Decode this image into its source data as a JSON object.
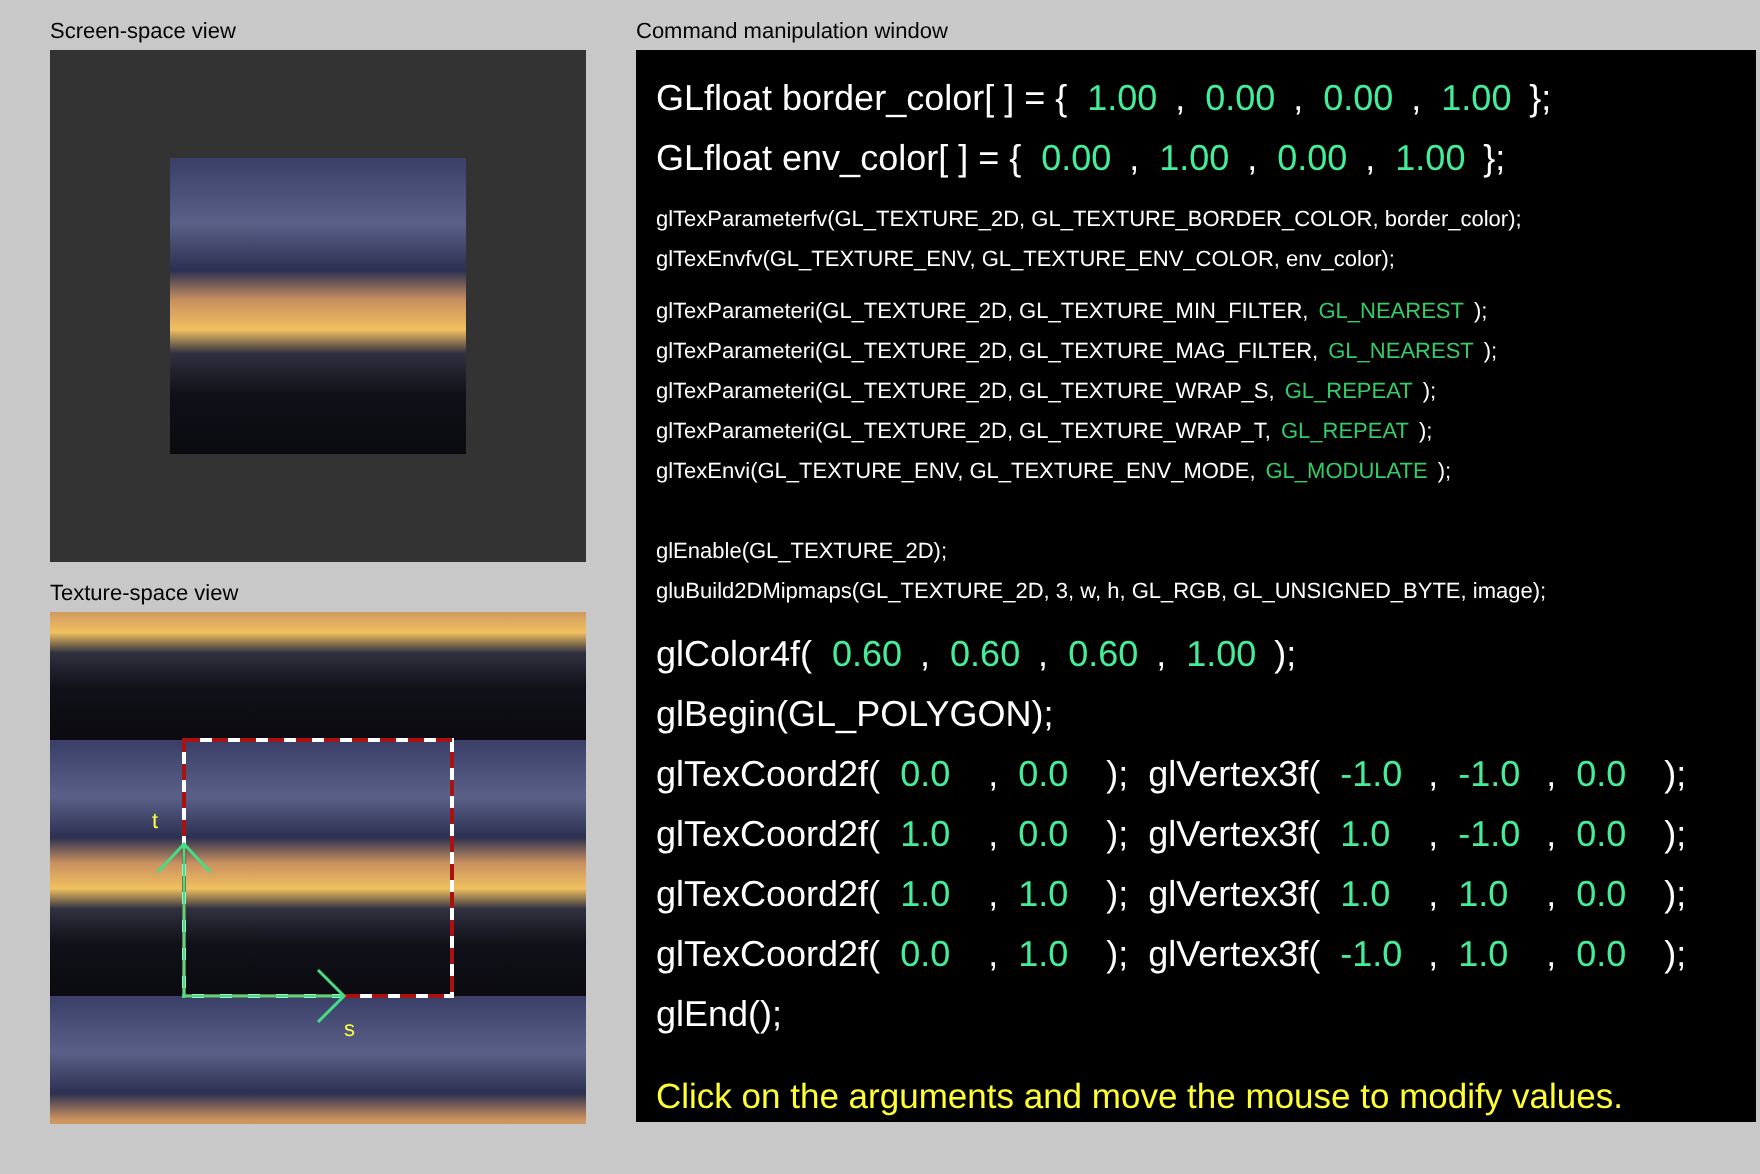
{
  "screen_view": {
    "title": "Screen-space view"
  },
  "texture_view": {
    "title": "Texture-space view",
    "t_label": "t",
    "s_label": "s"
  },
  "command_window": {
    "title": "Command manipulation window",
    "blocks": [
      [
        {
          "kind": "primary",
          "parts": [
            {
              "kind": "code",
              "text": "GLfloat border_color[ ] = {"
            },
            {
              "kind": "arg",
              "text": "1.00"
            },
            {
              "kind": "code",
              "text": ","
            },
            {
              "kind": "arg",
              "text": "0.00"
            },
            {
              "kind": "code",
              "text": ","
            },
            {
              "kind": "arg",
              "text": "0.00"
            },
            {
              "kind": "code",
              "text": ","
            },
            {
              "kind": "arg",
              "text": "1.00"
            },
            {
              "kind": "code",
              "text": "};"
            }
          ]
        },
        {
          "kind": "primary",
          "parts": [
            {
              "kind": "code",
              "text": "GLfloat env_color[ ] = {"
            },
            {
              "kind": "arg",
              "text": "0.00"
            },
            {
              "kind": "code",
              "text": ","
            },
            {
              "kind": "arg",
              "text": "1.00"
            },
            {
              "kind": "code",
              "text": ","
            },
            {
              "kind": "arg",
              "text": "0.00"
            },
            {
              "kind": "code",
              "text": ","
            },
            {
              "kind": "arg",
              "text": "1.00"
            },
            {
              "kind": "code",
              "text": "};"
            }
          ]
        }
      ],
      [
        {
          "kind": "secondary",
          "parts": [
            {
              "kind": "code",
              "text": "glTexParameterfv(GL_TEXTURE_2D, GL_TEXTURE_BORDER_COLOR, border_color);"
            }
          ]
        },
        {
          "kind": "secondary",
          "parts": [
            {
              "kind": "code",
              "text": "glTexEnvfv(GL_TEXTURE_ENV, GL_TEXTURE_ENV_COLOR, env_color);"
            }
          ]
        }
      ],
      [
        {
          "kind": "secondary",
          "parts": [
            {
              "kind": "code",
              "text": "glTexParameteri(GL_TEXTURE_2D, GL_TEXTURE_MIN_FILTER,"
            },
            {
              "kind": "arg",
              "text": "GL_NEAREST"
            },
            {
              "kind": "code",
              "text": ");"
            }
          ]
        },
        {
          "kind": "secondary",
          "parts": [
            {
              "kind": "code",
              "text": "glTexParameteri(GL_TEXTURE_2D, GL_TEXTURE_MAG_FILTER,"
            },
            {
              "kind": "arg",
              "text": "GL_NEAREST"
            },
            {
              "kind": "code",
              "text": ");"
            }
          ]
        },
        {
          "kind": "secondary",
          "parts": [
            {
              "kind": "code",
              "text": "glTexParameteri(GL_TEXTURE_2D, GL_TEXTURE_WRAP_S,"
            },
            {
              "kind": "arg",
              "text": "GL_REPEAT"
            },
            {
              "kind": "code",
              "text": ");"
            }
          ]
        },
        {
          "kind": "secondary",
          "parts": [
            {
              "kind": "code",
              "text": "glTexParameteri(GL_TEXTURE_2D, GL_TEXTURE_WRAP_T,"
            },
            {
              "kind": "arg",
              "text": "GL_REPEAT"
            },
            {
              "kind": "code",
              "text": ");"
            }
          ]
        },
        {
          "kind": "secondary",
          "parts": [
            {
              "kind": "code",
              "text": "glTexEnvi(GL_TEXTURE_ENV, GL_TEXTURE_ENV_MODE,"
            },
            {
              "kind": "arg",
              "text": "GL_MODULATE"
            },
            {
              "kind": "code",
              "text": ");"
            }
          ]
        }
      ],
      [
        {
          "kind": "secondary",
          "parts": [
            {
              "kind": "code",
              "text": "glEnable(GL_TEXTURE_2D);"
            }
          ]
        },
        {
          "kind": "secondary",
          "parts": [
            {
              "kind": "code",
              "text": "gluBuild2DMipmaps(GL_TEXTURE_2D, 3, w, h, GL_RGB, GL_UNSIGNED_BYTE, image);"
            }
          ]
        }
      ],
      [
        {
          "kind": "primary",
          "parts": [
            {
              "kind": "code",
              "text": "glColor4f("
            },
            {
              "kind": "arg",
              "text": "0.60"
            },
            {
              "kind": "code",
              "text": ","
            },
            {
              "kind": "arg",
              "text": "0.60"
            },
            {
              "kind": "code",
              "text": ","
            },
            {
              "kind": "arg",
              "text": "0.60"
            },
            {
              "kind": "code",
              "text": ","
            },
            {
              "kind": "arg",
              "text": "1.00"
            },
            {
              "kind": "code",
              "text": ");"
            }
          ]
        },
        {
          "kind": "primary",
          "parts": [
            {
              "kind": "code",
              "text": "glBegin(GL_POLYGON);"
            }
          ]
        },
        {
          "kind": "primary",
          "parts": [
            {
              "kind": "code",
              "text": "glTexCoord2f("
            },
            {
              "kind": "arg",
              "text": "0.0"
            },
            {
              "kind": "code",
              "text": ","
            },
            {
              "kind": "arg",
              "text": "0.0"
            },
            {
              "kind": "code",
              "text": ");  glVertex3f("
            },
            {
              "kind": "arg",
              "text": "-1.0"
            },
            {
              "kind": "code",
              "text": ","
            },
            {
              "kind": "arg",
              "text": "-1.0"
            },
            {
              "kind": "code",
              "text": ","
            },
            {
              "kind": "arg",
              "text": "0.0"
            },
            {
              "kind": "code",
              "text": ");"
            }
          ]
        },
        {
          "kind": "primary",
          "parts": [
            {
              "kind": "code",
              "text": "glTexCoord2f("
            },
            {
              "kind": "arg",
              "text": "1.0"
            },
            {
              "kind": "code",
              "text": ","
            },
            {
              "kind": "arg",
              "text": "0.0"
            },
            {
              "kind": "code",
              "text": ");  glVertex3f("
            },
            {
              "kind": "arg",
              "text": "1.0"
            },
            {
              "kind": "code",
              "text": ","
            },
            {
              "kind": "arg",
              "text": "-1.0"
            },
            {
              "kind": "code",
              "text": ","
            },
            {
              "kind": "arg",
              "text": "0.0"
            },
            {
              "kind": "code",
              "text": ");"
            }
          ]
        },
        {
          "kind": "primary",
          "parts": [
            {
              "kind": "code",
              "text": "glTexCoord2f("
            },
            {
              "kind": "arg",
              "text": "1.0"
            },
            {
              "kind": "code",
              "text": ","
            },
            {
              "kind": "arg",
              "text": "1.0"
            },
            {
              "kind": "code",
              "text": ");  glVertex3f("
            },
            {
              "kind": "arg",
              "text": "1.0"
            },
            {
              "kind": "code",
              "text": ","
            },
            {
              "kind": "arg",
              "text": "1.0"
            },
            {
              "kind": "code",
              "text": ","
            },
            {
              "kind": "arg",
              "text": "0.0"
            },
            {
              "kind": "code",
              "text": ");"
            }
          ]
        },
        {
          "kind": "primary",
          "parts": [
            {
              "kind": "code",
              "text": "glTexCoord2f("
            },
            {
              "kind": "arg",
              "text": "0.0"
            },
            {
              "kind": "code",
              "text": ","
            },
            {
              "kind": "arg",
              "text": "1.0"
            },
            {
              "kind": "code",
              "text": ");  glVertex3f("
            },
            {
              "kind": "arg",
              "text": "-1.0"
            },
            {
              "kind": "code",
              "text": ","
            },
            {
              "kind": "arg",
              "text": "1.0"
            },
            {
              "kind": "code",
              "text": ","
            },
            {
              "kind": "arg",
              "text": "0.0"
            },
            {
              "kind": "code",
              "text": ");"
            }
          ]
        },
        {
          "kind": "primary",
          "parts": [
            {
              "kind": "code",
              "text": "glEnd();"
            }
          ]
        }
      ]
    ],
    "hint": "Click on the arguments and move the mouse to modify values."
  }
}
